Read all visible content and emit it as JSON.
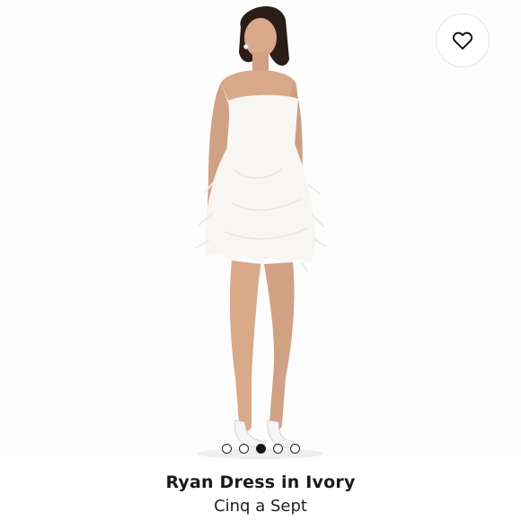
{
  "product": {
    "name": "Ryan Dress in Ivory",
    "brand": "Cinq a Sept"
  },
  "wishlist": {
    "icon": "heart-outline-icon"
  },
  "carousel": {
    "dots": [
      {
        "active": false
      },
      {
        "active": false
      },
      {
        "active": true
      },
      {
        "active": false
      },
      {
        "active": false
      }
    ]
  },
  "colors": {
    "dress": "#f7f6f2",
    "skin": "#d9a98a",
    "hair": "#2a1d18",
    "background": "#fdfdfd"
  }
}
